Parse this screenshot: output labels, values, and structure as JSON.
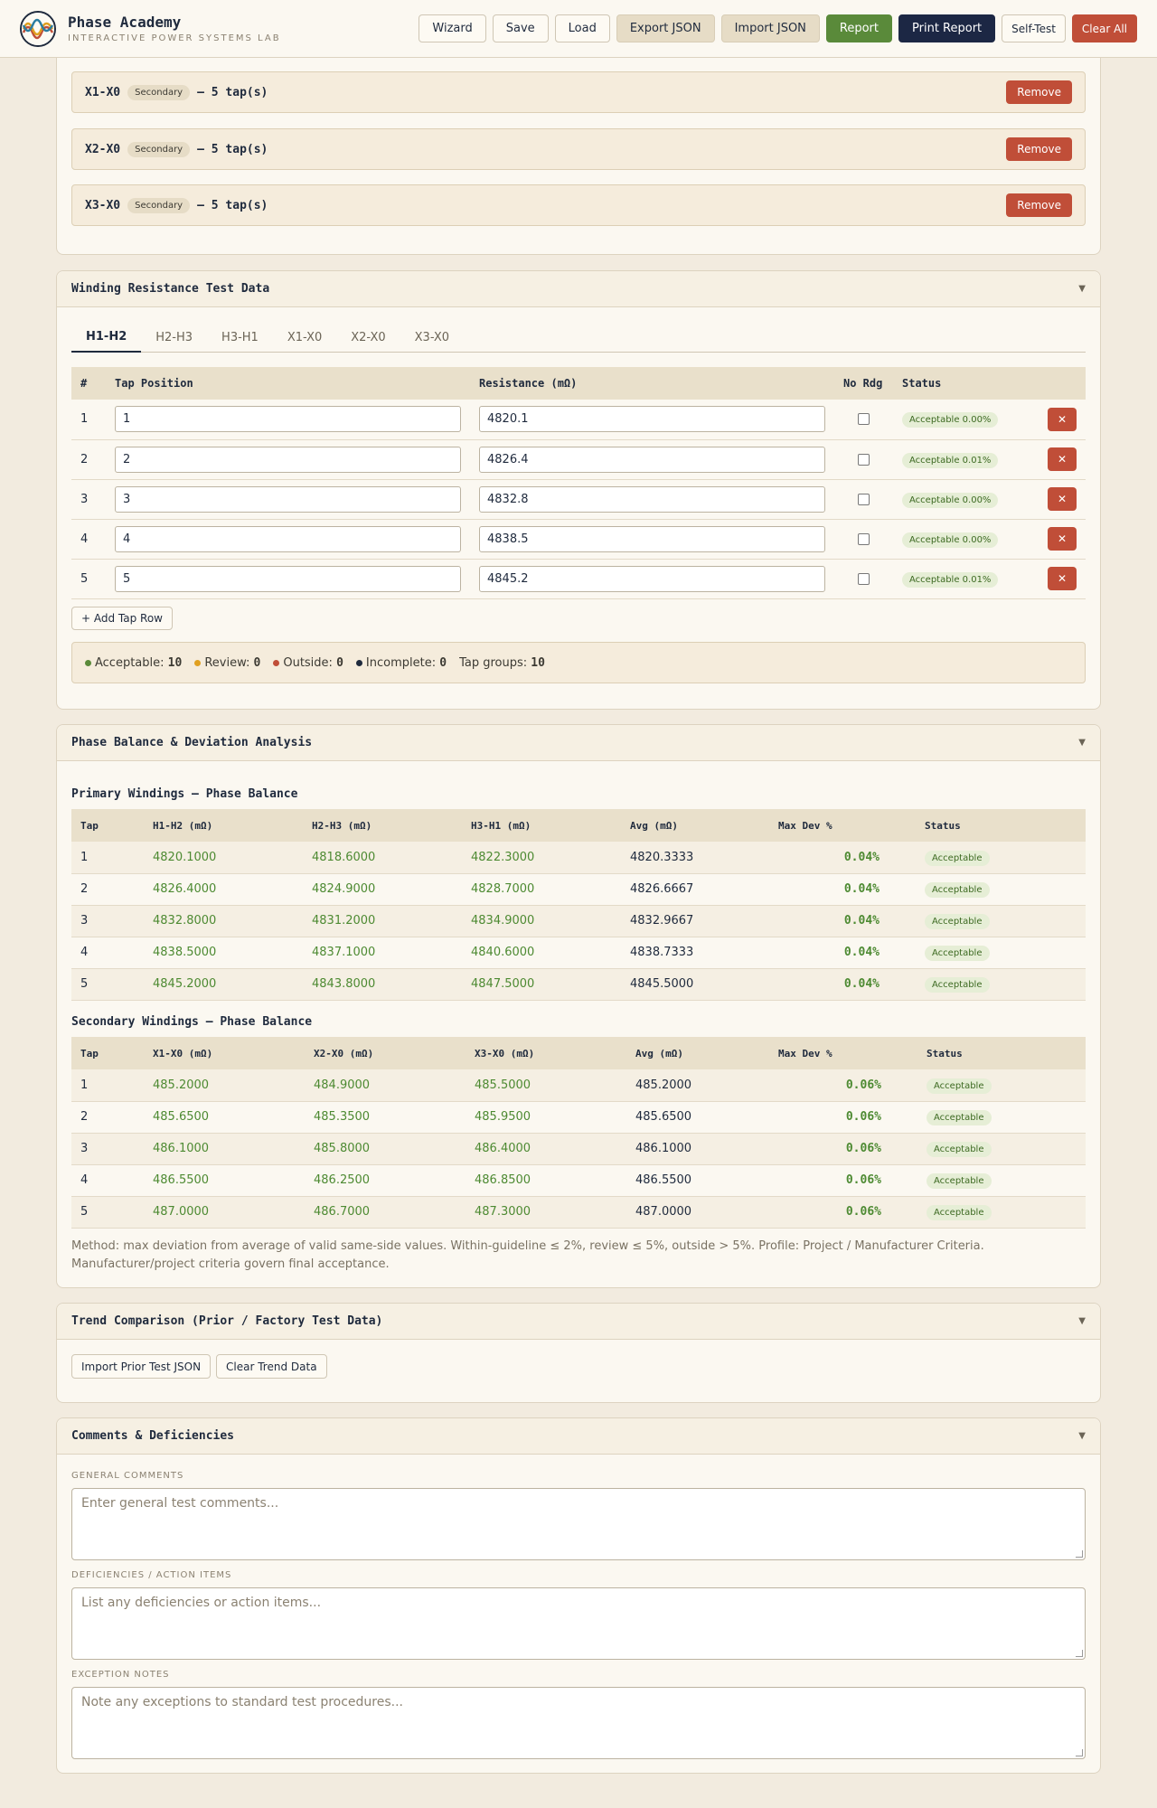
{
  "app": {
    "title": "Phase Academy",
    "subtitle": "INTERACTIVE POWER SYSTEMS LAB"
  },
  "toolbar": {
    "wizard": "Wizard",
    "save": "Save",
    "load": "Load",
    "export": "Export JSON",
    "import": "Import JSON",
    "report": "Report",
    "print": "Print Report",
    "selftest": "Self-Test",
    "clear": "Clear All"
  },
  "groups": [
    {
      "name": "X1-X0",
      "side": "Secondary",
      "taps": "— 5 tap(s)",
      "remove": "Remove"
    },
    {
      "name": "X2-X0",
      "side": "Secondary",
      "taps": "— 5 tap(s)",
      "remove": "Remove"
    },
    {
      "name": "X3-X0",
      "side": "Secondary",
      "taps": "— 5 tap(s)",
      "remove": "Remove"
    }
  ],
  "resistance": {
    "title": "Winding Resistance Test Data",
    "tabs": [
      "H1-H2",
      "H2-H3",
      "H3-H1",
      "X1-X0",
      "X2-X0",
      "X3-X0"
    ],
    "headers": [
      "#",
      "Tap Position",
      "Resistance (mΩ)",
      "No Rdg",
      "Status"
    ],
    "rows": [
      {
        "n": "1",
        "tap": "1",
        "res": "4820.1",
        "status": "Acceptable 0.00%"
      },
      {
        "n": "2",
        "tap": "2",
        "res": "4826.4",
        "status": "Acceptable 0.01%"
      },
      {
        "n": "3",
        "tap": "3",
        "res": "4832.8",
        "status": "Acceptable 0.00%"
      },
      {
        "n": "4",
        "tap": "4",
        "res": "4838.5",
        "status": "Acceptable 0.00%"
      },
      {
        "n": "5",
        "tap": "5",
        "res": "4845.2",
        "status": "Acceptable 0.01%"
      }
    ],
    "remove_icon": "✕",
    "add_row": "+ Add Tap Row",
    "summary": {
      "acceptable_label": "Acceptable:",
      "acceptable": "10",
      "review_label": "Review:",
      "review": "0",
      "outside_label": "Outside:",
      "outside": "0",
      "incomplete_label": "Incomplete:",
      "incomplete": "0",
      "groups_label": "Tap groups:",
      "groups": "10"
    },
    "colors": {
      "acceptable": "#5a8a3a",
      "review": "#e0a020",
      "outside": "#c04e38",
      "incomplete": "#1f2a3d"
    }
  },
  "balance": {
    "title": "Phase Balance & Deviation Analysis",
    "primary": {
      "title": "Primary Windings — Phase Balance",
      "headers": [
        "Tap",
        "H1-H2 (mΩ)",
        "H2-H3 (mΩ)",
        "H3-H1 (mΩ)",
        "Avg (mΩ)",
        "Max Dev %",
        "Status"
      ],
      "rows": [
        [
          "1",
          "4820.1000",
          "4818.6000",
          "4822.3000",
          "4820.3333",
          "0.04%",
          "Acceptable"
        ],
        [
          "2",
          "4826.4000",
          "4824.9000",
          "4828.7000",
          "4826.6667",
          "0.04%",
          "Acceptable"
        ],
        [
          "3",
          "4832.8000",
          "4831.2000",
          "4834.9000",
          "4832.9667",
          "0.04%",
          "Acceptable"
        ],
        [
          "4",
          "4838.5000",
          "4837.1000",
          "4840.6000",
          "4838.7333",
          "0.04%",
          "Acceptable"
        ],
        [
          "5",
          "4845.2000",
          "4843.8000",
          "4847.5000",
          "4845.5000",
          "0.04%",
          "Acceptable"
        ]
      ]
    },
    "secondary": {
      "title": "Secondary Windings — Phase Balance",
      "headers": [
        "Tap",
        "X1-X0 (mΩ)",
        "X2-X0 (mΩ)",
        "X3-X0 (mΩ)",
        "Avg (mΩ)",
        "Max Dev %",
        "Status"
      ],
      "rows": [
        [
          "1",
          "485.2000",
          "484.9000",
          "485.5000",
          "485.2000",
          "0.06%",
          "Acceptable"
        ],
        [
          "2",
          "485.6500",
          "485.3500",
          "485.9500",
          "485.6500",
          "0.06%",
          "Acceptable"
        ],
        [
          "3",
          "486.1000",
          "485.8000",
          "486.4000",
          "486.1000",
          "0.06%",
          "Acceptable"
        ],
        [
          "4",
          "486.5500",
          "486.2500",
          "486.8500",
          "486.5500",
          "0.06%",
          "Acceptable"
        ],
        [
          "5",
          "487.0000",
          "486.7000",
          "487.3000",
          "487.0000",
          "0.06%",
          "Acceptable"
        ]
      ]
    },
    "method": "Method: max deviation from average of valid same-side values. Within-guideline ≤ 2%, review ≤ 5%, outside > 5%. Profile: Project / Manufacturer Criteria. Manufacturer/project criteria govern final acceptance."
  },
  "trend": {
    "title": "Trend Comparison (Prior / Factory Test Data)",
    "import": "Import Prior Test JSON",
    "clear": "Clear Trend Data"
  },
  "comments": {
    "title": "Comments & Deficiencies",
    "general_label": "GENERAL COMMENTS",
    "general_placeholder": "Enter general test comments...",
    "def_label": "DEFICIENCIES / ACTION ITEMS",
    "def_placeholder": "List any deficiencies or action items...",
    "exc_label": "EXCEPTION NOTES",
    "exc_placeholder": "Note any exceptions to standard test procedures..."
  }
}
